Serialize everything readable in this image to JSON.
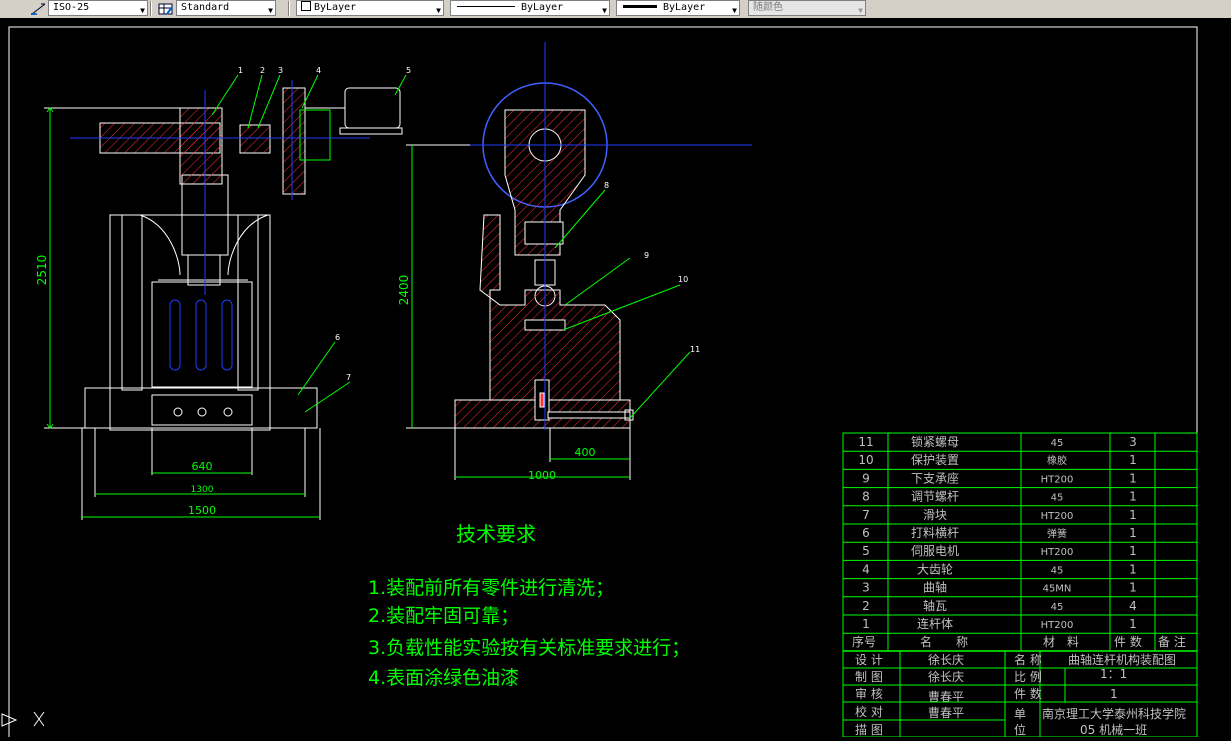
{
  "toolbar": {
    "dimstyle": "ISO-25",
    "tablestyle": "Standard",
    "layer_color": "ByLayer",
    "linetype": "ByLayer",
    "lineweight": "ByLayer",
    "plotstyle": "随颜色"
  },
  "drawing": {
    "front_view": {
      "height_dim": "2510",
      "width_dims": [
        "640",
        "1300",
        "1500"
      ],
      "part_refs": [
        "1",
        "2",
        "3",
        "4",
        "5",
        "6",
        "7"
      ]
    },
    "side_view": {
      "height_dim": "2400",
      "width_dims": [
        "400",
        "1000"
      ],
      "part_refs": [
        "8",
        "9",
        "10",
        "11"
      ]
    }
  },
  "requirements": {
    "title": "技术要求",
    "items": [
      "1.装配前所有零件进行清洗；",
      "2.装配牢固可靠；",
      "3.负载性能实验按有关标准要求进行；",
      "4.表面涂绿色油漆"
    ]
  },
  "bom": {
    "rows": [
      {
        "no": "11",
        "name": "锁紧螺母",
        "material": "45",
        "qty": "3"
      },
      {
        "no": "10",
        "name": "保护装置",
        "material": "橡胶",
        "qty": "1"
      },
      {
        "no": "9",
        "name": "下支承座",
        "material": "HT200",
        "qty": "1"
      },
      {
        "no": "8",
        "name": "调节螺杆",
        "material": "45",
        "qty": "1"
      },
      {
        "no": "7",
        "name": "滑块",
        "material": "HT200",
        "qty": "1"
      },
      {
        "no": "6",
        "name": "打料横杆",
        "material": "弹簧",
        "qty": "1"
      },
      {
        "no": "5",
        "name": "伺服电机",
        "material": "HT200",
        "qty": "1"
      },
      {
        "no": "4",
        "name": "大齿轮",
        "material": "45",
        "qty": "1"
      },
      {
        "no": "3",
        "name": "曲轴",
        "material": "45MN",
        "qty": "1"
      },
      {
        "no": "2",
        "name": "轴瓦",
        "material": "45",
        "qty": "4"
      },
      {
        "no": "1",
        "name": "连杆体",
        "material": "HT200",
        "qty": "1"
      }
    ],
    "headers": {
      "no": "序号",
      "name": "名　　称",
      "material": "材　料",
      "qty": "件 数",
      "note": "备 注"
    }
  },
  "titleblock": {
    "design_label": "设 计",
    "design_name": "徐长庆",
    "draw_label": "制 图",
    "draw_name": "徐长庆",
    "review_label": "审 核",
    "review_name": "曹春平",
    "check_label": "校 对",
    "check_name": "曹春平",
    "trace_label": "描 图",
    "title_label": "名 称",
    "title_value": "曲轴连杆机构装配图",
    "scale_label": "比 例",
    "scale_value": "1：1",
    "count_label": "件 数",
    "count_value": "1",
    "unit_label_1": "单",
    "unit_label_2": "位",
    "unit_value_1": "南京理工大学泰州科技学院",
    "unit_value_2": "05 机械一班"
  },
  "colors": {
    "line_green": "#00ff00",
    "text_white": "#ffffff",
    "hatch_red": "#ff3030",
    "center_blue": "#1e3cff",
    "table_text": "#c0c0c0"
  }
}
